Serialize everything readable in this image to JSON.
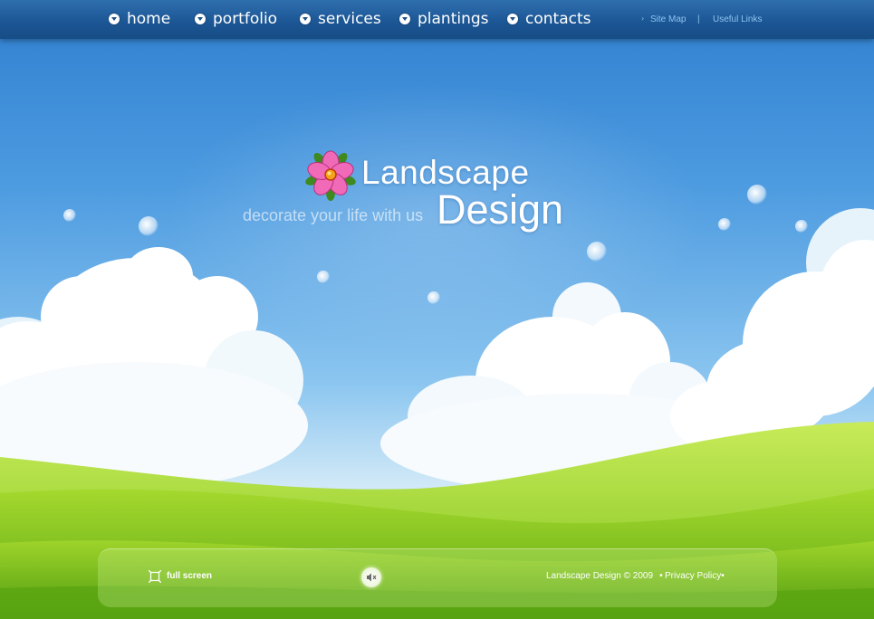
{
  "nav": {
    "items": [
      {
        "label": "home"
      },
      {
        "label": "portfolio"
      },
      {
        "label": "services"
      },
      {
        "label": "plantings"
      },
      {
        "label": "contacts"
      }
    ],
    "site_map": "Site Map",
    "separator": "|",
    "useful_links": "Useful Links"
  },
  "logo": {
    "line1": "Landscape",
    "line2": "Design",
    "tagline": "decorate your life with us"
  },
  "footer": {
    "full_screen": "full screen",
    "copyright": "Landscape Design © 2009",
    "privacy": "Privacy Policy"
  },
  "icons": {
    "nav_bullet": "chevron-down-icon",
    "logo": "flower-icon",
    "full_screen": "fullscreen-icon",
    "sound": "speaker-icon"
  },
  "colors": {
    "nav_bar": "#1b5593",
    "sky_top": "#2f7fd0",
    "grass": "#7cc21a",
    "flower_petal": "#f06ab8"
  }
}
